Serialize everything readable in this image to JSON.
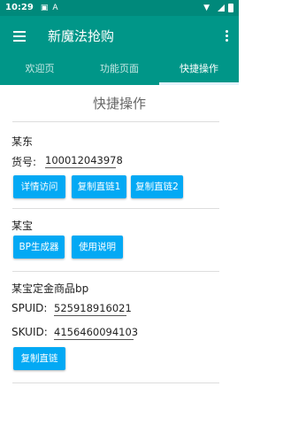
{
  "status_bar": {
    "time": "10:29",
    "icons": [
      "image-icon",
      "text-icon",
      "wifi-icon",
      "signal-icon",
      "battery-icon"
    ]
  },
  "app_bar": {
    "title": "新魔法抢购"
  },
  "tabs": [
    {
      "label": "欢迎页",
      "active": false
    },
    {
      "label": "功能页面",
      "active": false
    },
    {
      "label": "快捷操作",
      "active": true
    }
  ],
  "page": {
    "title": "快捷操作"
  },
  "jd": {
    "heading": "某东",
    "item_label": "货号:",
    "item_value": "100012043978",
    "buttons": [
      "详情访问",
      "复制直链1",
      "复制直链2"
    ]
  },
  "taobao": {
    "heading": "某宝",
    "buttons": [
      "BP生成器",
      "使用说明"
    ]
  },
  "deposit": {
    "heading": "某宝定金商品bp",
    "spuid_label": "SPUID:",
    "spuid_value": "525918916021",
    "skuid_label": "SKUID:",
    "skuid_value": "4156460094103",
    "button": "复制直链"
  },
  "colors": {
    "primary": "#009688",
    "status_bar": "#00897b",
    "button": "#03a9f4",
    "tab_indicator": "#e3f2fd"
  }
}
